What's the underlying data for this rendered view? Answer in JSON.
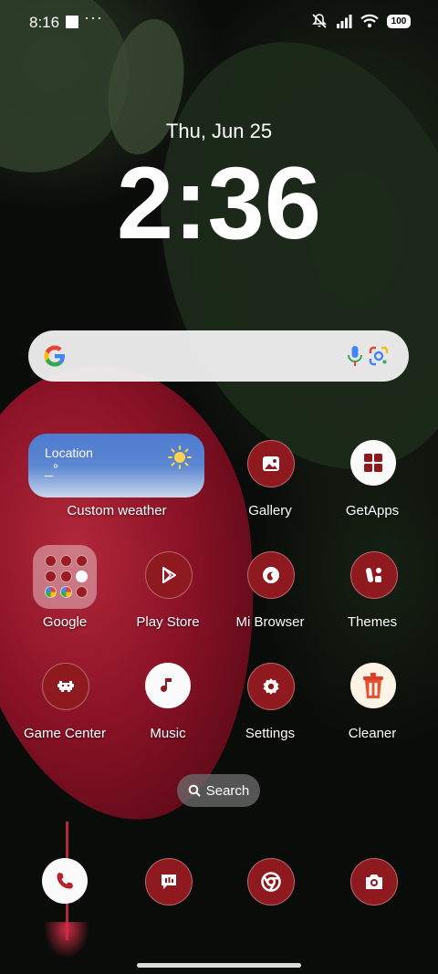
{
  "status_bar": {
    "time": "8:16",
    "more_indicator": "···",
    "battery": "100",
    "icons": [
      "notification-square-icon",
      "mute-icon",
      "signal-icon",
      "wifi-icon",
      "battery-icon"
    ]
  },
  "lockscreen": {
    "date": "Thu, Jun 25",
    "clock": "2:36"
  },
  "search_bar": {
    "icons": [
      "google-g-icon",
      "voice-search-icon",
      "google-lens-icon"
    ]
  },
  "weather_widget": {
    "location": "Location",
    "condition": "_°",
    "label": "Custom weather",
    "icon": "sun-icon"
  },
  "apps": {
    "gallery": "Gallery",
    "getapps": "GetApps",
    "google": "Google",
    "play_store": "Play Store",
    "mi_browser": "Mi Browser",
    "themes": "Themes",
    "game_center": "Game Center",
    "music": "Music",
    "settings": "Settings",
    "cleaner": "Cleaner"
  },
  "app_search": {
    "label": "Search"
  },
  "dock": [
    "phone-icon",
    "messages-icon",
    "chrome-icon",
    "camera-icon"
  ],
  "colors": {
    "icon_red": "#8e1a1f",
    "search_bg": "#eeeeee",
    "widget_blue": "#4e7bd0"
  }
}
